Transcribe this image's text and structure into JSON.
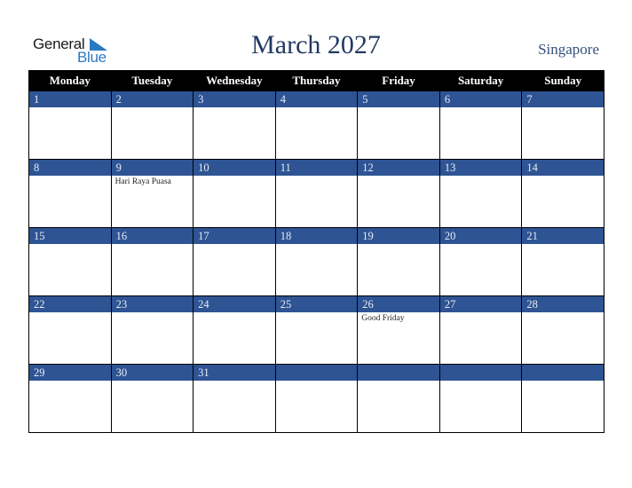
{
  "brand": {
    "line1": "General",
    "line2": "Blue",
    "accent_color": "#2a7ac0"
  },
  "header": {
    "title": "March 2027",
    "region": "Singapore"
  },
  "colors": {
    "title": "#213a63",
    "day_bar": "#2e5494",
    "header_bg": "#000000"
  },
  "weekdays": [
    "Monday",
    "Tuesday",
    "Wednesday",
    "Thursday",
    "Friday",
    "Saturday",
    "Sunday"
  ],
  "weeks": [
    [
      {
        "day": "1",
        "event": ""
      },
      {
        "day": "2",
        "event": ""
      },
      {
        "day": "3",
        "event": ""
      },
      {
        "day": "4",
        "event": ""
      },
      {
        "day": "5",
        "event": ""
      },
      {
        "day": "6",
        "event": ""
      },
      {
        "day": "7",
        "event": ""
      }
    ],
    [
      {
        "day": "8",
        "event": ""
      },
      {
        "day": "9",
        "event": "Hari Raya Puasa"
      },
      {
        "day": "10",
        "event": ""
      },
      {
        "day": "11",
        "event": ""
      },
      {
        "day": "12",
        "event": ""
      },
      {
        "day": "13",
        "event": ""
      },
      {
        "day": "14",
        "event": ""
      }
    ],
    [
      {
        "day": "15",
        "event": ""
      },
      {
        "day": "16",
        "event": ""
      },
      {
        "day": "17",
        "event": ""
      },
      {
        "day": "18",
        "event": ""
      },
      {
        "day": "19",
        "event": ""
      },
      {
        "day": "20",
        "event": ""
      },
      {
        "day": "21",
        "event": ""
      }
    ],
    [
      {
        "day": "22",
        "event": ""
      },
      {
        "day": "23",
        "event": ""
      },
      {
        "day": "24",
        "event": ""
      },
      {
        "day": "25",
        "event": ""
      },
      {
        "day": "26",
        "event": "Good Friday"
      },
      {
        "day": "27",
        "event": ""
      },
      {
        "day": "28",
        "event": ""
      }
    ],
    [
      {
        "day": "29",
        "event": ""
      },
      {
        "day": "30",
        "event": ""
      },
      {
        "day": "31",
        "event": ""
      },
      {
        "day": "",
        "event": ""
      },
      {
        "day": "",
        "event": ""
      },
      {
        "day": "",
        "event": ""
      },
      {
        "day": "",
        "event": ""
      }
    ]
  ]
}
